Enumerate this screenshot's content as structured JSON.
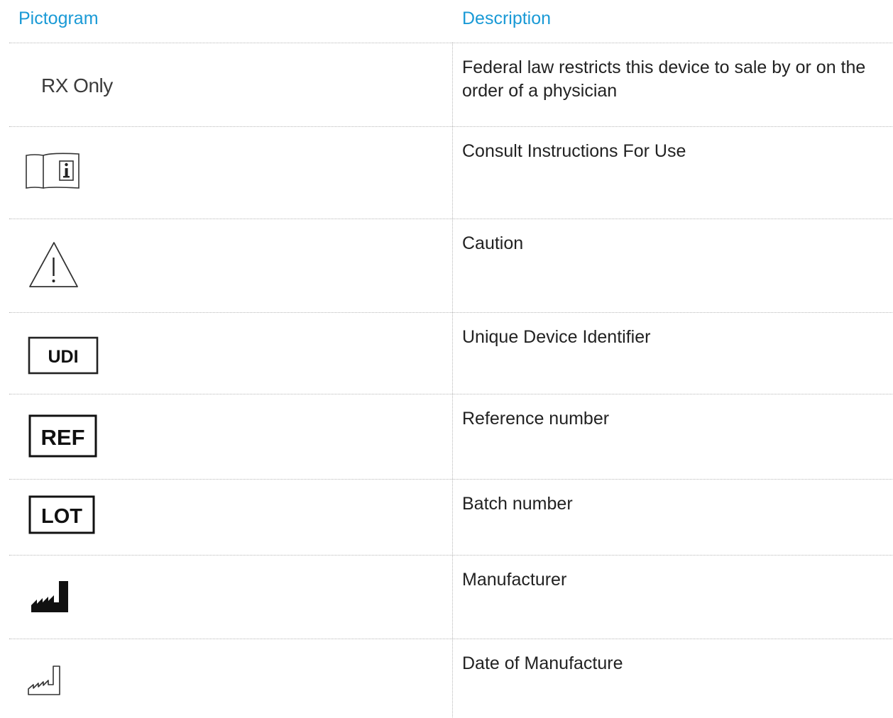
{
  "table": {
    "headers": {
      "pictogram": "Pictogram",
      "description": "Description"
    },
    "rows": [
      {
        "symbol": "rx-only",
        "symbol_text": "RX Only",
        "description": "Federal law restricts this device to sale by or on the order of a physician"
      },
      {
        "symbol": "consult-instructions-icon",
        "description": "Consult Instructions For Use"
      },
      {
        "symbol": "caution-icon",
        "description": "Caution"
      },
      {
        "symbol": "udi-icon",
        "symbol_text": "UDI",
        "description": "Unique Device Identifier"
      },
      {
        "symbol": "ref-icon",
        "symbol_text": "REF",
        "description": "Reference number"
      },
      {
        "symbol": "lot-icon",
        "symbol_text": "LOT",
        "description": "Batch number"
      },
      {
        "symbol": "manufacturer-icon",
        "description": "Manufacturer"
      },
      {
        "symbol": "date-of-manufacture-icon",
        "description": "Date of Manufacture"
      }
    ]
  },
  "colors": {
    "header_text": "#1a9ad6",
    "body_text": "#222222",
    "grid_lines": "#b8b8b8"
  }
}
